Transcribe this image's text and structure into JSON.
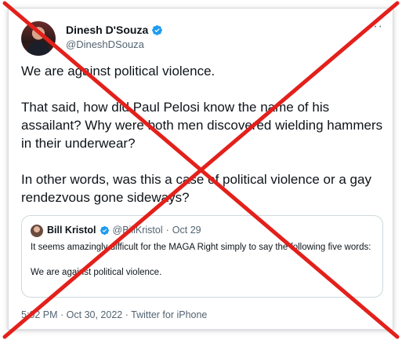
{
  "author": {
    "name": "Dinesh D'Souza",
    "handle": "@DineshDSouza",
    "more": "···"
  },
  "tweet": {
    "paragraphs": [
      "We are against political violence.",
      "That said, how did Paul Pelosi know the name of his assailant? Why were both men discovered wielding hammers in their underwear?",
      "In other words, was this a case of political violence or a gay rendezvous gone sideways?"
    ]
  },
  "quote": {
    "name": "Bill Kristol",
    "handle": "@BillKristol",
    "separator": "·",
    "date": "Oct 29",
    "paragraphs": [
      "It seems amazingly difficult for the MAGA Right simply to say the following five words:",
      "We are against political violence."
    ]
  },
  "meta": {
    "timestamp": "5:02 PM · Oct 30, 2022 · Twitter for iPhone"
  },
  "colors": {
    "verified": "#1d9bf0",
    "x_mark": "#e3201b"
  },
  "icons": {
    "verified": "verified-badge-icon",
    "more": "more-icon"
  }
}
